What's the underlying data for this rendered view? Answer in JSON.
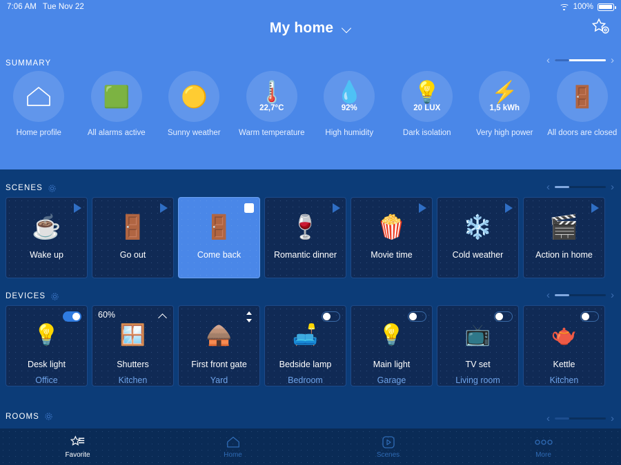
{
  "statusbar": {
    "time": "7:06 AM",
    "date": "Tue Nov 22",
    "wifi_icon": "wifi-icon",
    "battery_percent": "100%",
    "battery_icon": "battery-full-icon"
  },
  "header": {
    "title": "My home",
    "dropdown_icon": "chevron-down-icon",
    "favorites_settings_icon": "star-gear-icon",
    "background_color": "#4a87e8"
  },
  "summary": {
    "label": "SUMMARY",
    "scroll": {
      "prev_icon": "chevron-left-icon",
      "next_icon": "chevron-right-icon"
    },
    "items": [
      {
        "icon": "home-outline-icon",
        "emoji": "",
        "value": "",
        "label": "Home profile"
      },
      {
        "icon": "alarm-panel-icon",
        "emoji": "🟩",
        "value": "",
        "label": "All alarms active"
      },
      {
        "icon": "sun-icon",
        "emoji": "🟡",
        "value": "",
        "label": "Sunny weather"
      },
      {
        "icon": "thermometer-icon",
        "emoji": "🌡️",
        "value": "22,7°C",
        "label": "Warm temperature"
      },
      {
        "icon": "water-drop-icon",
        "emoji": "💧",
        "value": "92%",
        "label": "High humidity"
      },
      {
        "icon": "light-sensor-icon",
        "emoji": "💡",
        "value": "20 LUX",
        "label": "Dark isolation"
      },
      {
        "icon": "lightning-bolt-icon",
        "emoji": "⚡",
        "value": "1,5 kWh",
        "label": "Very high power"
      },
      {
        "icon": "door-icon",
        "emoji": "🚪",
        "value": "",
        "label": "All doors are closed"
      }
    ]
  },
  "scenes": {
    "label": "SCENES",
    "settings_icon": "gear-icon",
    "scroll": {
      "prev_icon": "chevron-left-icon",
      "next_icon": "chevron-right-icon"
    },
    "items": [
      {
        "name": "Wake up",
        "emoji": "☕",
        "action_icon": "play-icon",
        "selected": false
      },
      {
        "name": "Go out",
        "emoji": "🚪",
        "action_icon": "play-icon",
        "selected": false
      },
      {
        "name": "Come back",
        "emoji": "🚪",
        "action_icon": "stop-icon",
        "selected": true
      },
      {
        "name": "Romantic dinner",
        "emoji": "🍷",
        "action_icon": "play-icon",
        "selected": false
      },
      {
        "name": "Movie time",
        "emoji": "🍿",
        "action_icon": "play-icon",
        "selected": false
      },
      {
        "name": "Cold weather",
        "emoji": "❄️",
        "action_icon": "play-icon",
        "selected": false
      },
      {
        "name": "Action in home",
        "emoji": "🎬",
        "action_icon": "play-icon",
        "selected": false
      }
    ]
  },
  "devices": {
    "label": "DEVICES",
    "settings_icon": "gear-icon",
    "scroll": {
      "prev_icon": "chevron-left-icon",
      "next_icon": "chevron-right-icon"
    },
    "items": [
      {
        "name": "Desk light",
        "room": "Office",
        "emoji": "💡",
        "control": "toggle",
        "state": "on",
        "value": ""
      },
      {
        "name": "Shutters",
        "room": "Kitchen",
        "emoji": "🪟",
        "control": "chevron-up",
        "state": "",
        "value": "60%"
      },
      {
        "name": "First front gate",
        "room": "Yard",
        "emoji": "🛖",
        "control": "updown",
        "state": "",
        "value": ""
      },
      {
        "name": "Bedside lamp",
        "room": "Bedroom",
        "emoji": "🛋️",
        "control": "toggle",
        "state": "off",
        "value": ""
      },
      {
        "name": "Main light",
        "room": "Garage",
        "emoji": "💡",
        "control": "toggle",
        "state": "off",
        "value": ""
      },
      {
        "name": "TV set",
        "room": "Living room",
        "emoji": "📺",
        "control": "toggle",
        "state": "off",
        "value": ""
      },
      {
        "name": "Kettle",
        "room": "Kitchen",
        "emoji": "🫖",
        "control": "toggle",
        "state": "off",
        "value": ""
      }
    ]
  },
  "rooms": {
    "label": "ROOMS",
    "settings_icon": "gear-icon",
    "scroll": {
      "prev_icon": "chevron-left-icon",
      "next_icon": "chevron-right-icon"
    }
  },
  "bottom_nav": {
    "items": [
      {
        "label": "Favorite",
        "icon": "star-list-icon",
        "active": true
      },
      {
        "label": "Home",
        "icon": "home-outline-icon",
        "active": false
      },
      {
        "label": "Scenes",
        "icon": "play-square-icon",
        "active": false
      },
      {
        "label": "More",
        "icon": "ellipsis-icon",
        "active": false
      }
    ]
  },
  "colors": {
    "header_blue": "#4a87e8",
    "body_navy": "#0c3c78",
    "card_navy": "#102a55",
    "nav_navy": "#0a2b56",
    "accent_room": "#6fa4ea",
    "toggle_on": "#2f7be0"
  }
}
